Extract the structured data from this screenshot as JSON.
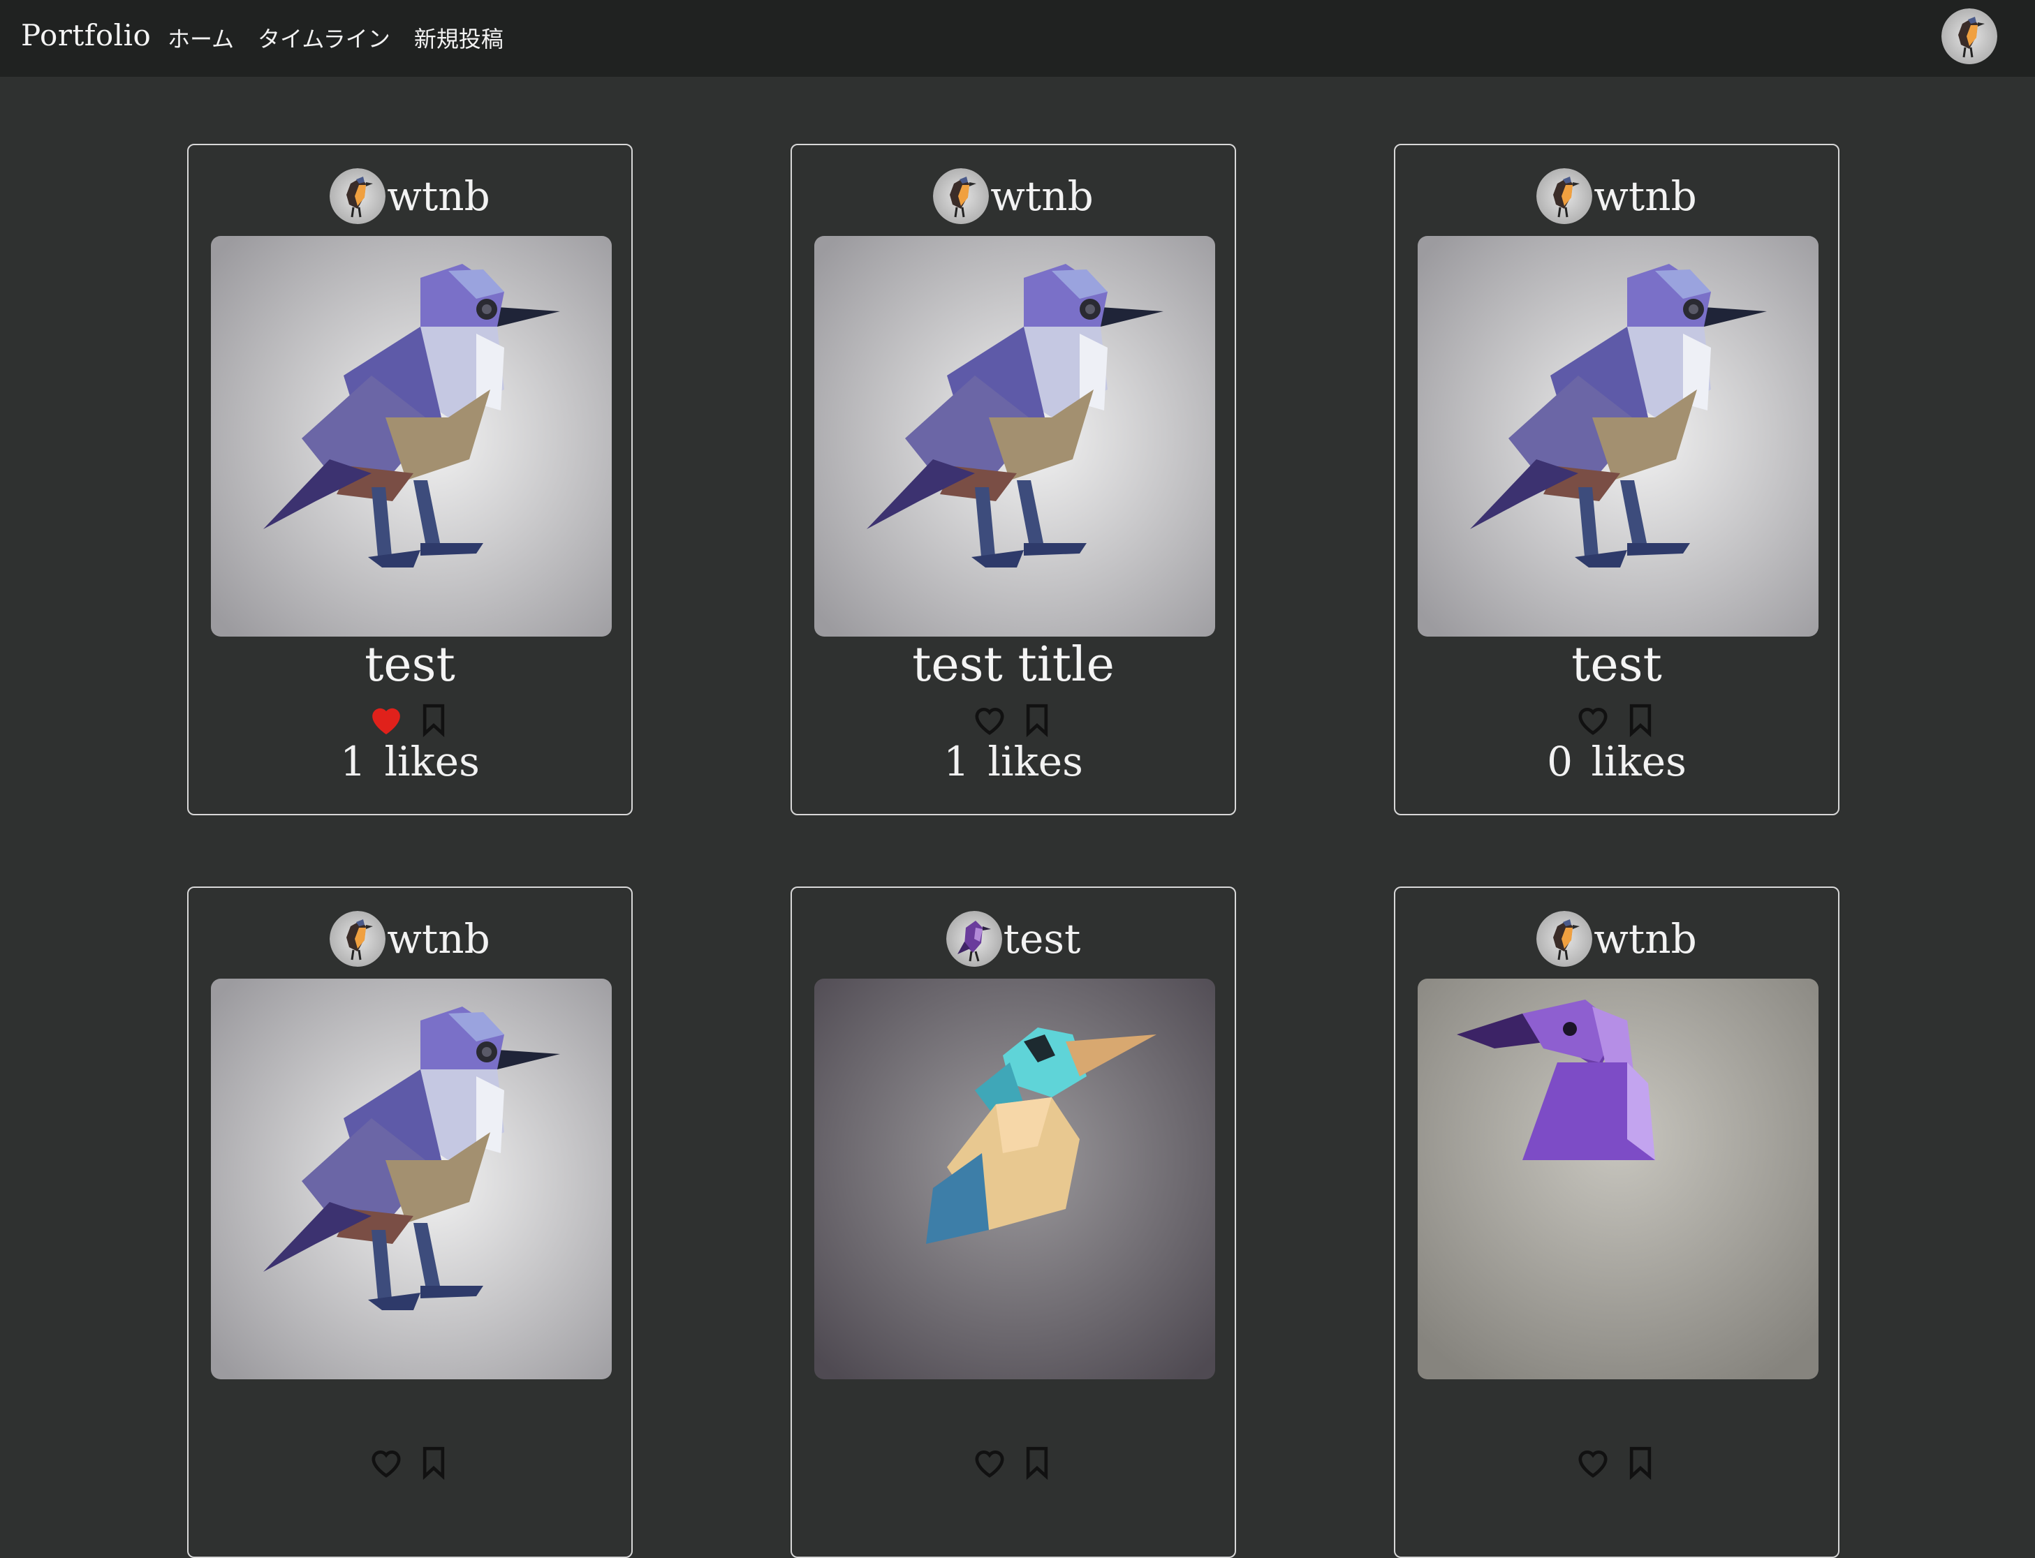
{
  "navbar": {
    "brand": "Portfolio",
    "links": [
      "ホーム",
      "タイムライン",
      "新規投稿"
    ]
  },
  "posts": [
    {
      "user": "wtnb",
      "title": "test",
      "likes": "1 likes",
      "liked": true,
      "image": "purple-sparrow",
      "avatar": "robin"
    },
    {
      "user": "wtnb",
      "title": "test title",
      "likes": "1 likes",
      "liked": false,
      "image": "purple-sparrow",
      "avatar": "robin"
    },
    {
      "user": "wtnb",
      "title": "test",
      "likes": "0 likes",
      "liked": false,
      "image": "purple-sparrow",
      "avatar": "robin"
    },
    {
      "user": "wtnb",
      "title": "",
      "likes": "",
      "liked": false,
      "image": "purple-sparrow",
      "avatar": "robin"
    },
    {
      "user": "test",
      "title": "",
      "likes": "",
      "liked": false,
      "image": "kingfisher",
      "avatar": "purple-bird"
    },
    {
      "user": "wtnb",
      "title": "",
      "likes": "",
      "liked": false,
      "image": "purple-crow",
      "avatar": "robin"
    }
  ],
  "colors": {
    "background": "#2f3130",
    "navbar": "#202221",
    "card_border": "#d8d8d8",
    "liked_heart": "#e0211b"
  },
  "icons": {
    "like": "heart-icon",
    "bookmark": "bookmark-icon"
  }
}
